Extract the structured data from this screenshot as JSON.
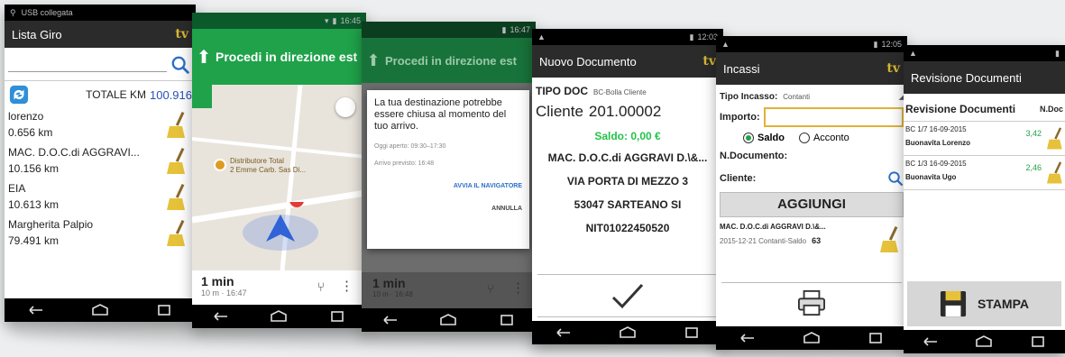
{
  "colors": {
    "accent_green": "#1fa24a",
    "brand_yellow": "#d7b733",
    "status_green": "#22c34a",
    "link_blue": "#2a6fc9"
  },
  "status": {
    "p1": "USB collegata",
    "p2_time": "16:45",
    "p3_time": "16:47",
    "p4_time": "12:03",
    "p5_time": "12:05"
  },
  "p1": {
    "title": "Lista Giro",
    "logo": "tv",
    "total_label": "TOTALE KM",
    "total_value": "100.916",
    "items": [
      {
        "name": "lorenzo",
        "km": "0.656 km"
      },
      {
        "name": "MAC. D.O.C.di AGGRAVI...",
        "km": "10.156 km"
      },
      {
        "name": "EIA",
        "km": "10.613 km"
      },
      {
        "name": "Margherita Palpio",
        "km": "79.491 km"
      }
    ]
  },
  "p2": {
    "title": "Procedi in direzione est",
    "place_line1": "Distributore Total",
    "place_line2": "2 Emme Carb. Sas Di...",
    "eta_time": "1 min",
    "eta_sub": "10 m · 16:47"
  },
  "p3": {
    "title": "Procedi in direzione est",
    "dialog_text": "La tua destinazione potrebbe essere chiusa al momento del tuo arrivo.",
    "open_line": "Oggi aperto: 09:30–17:30",
    "arrival_line": "Arrivo previsto: 16:48",
    "start_nav": "AVVIA IL NAVIGATORE",
    "cancel": "ANNULLA",
    "eta_time": "1 min",
    "eta_sub": "10 m · 16:48"
  },
  "p4": {
    "title": "Nuovo Documento",
    "logo": "tv",
    "tipo_label": "TIPO DOC",
    "tipo_value": "BC-Bolla Cliente",
    "cliente_label": "Cliente",
    "cliente_value": "201.00002",
    "saldo": "Saldo: 0,00 €",
    "addr1": "MAC. D.O.C.di AGGRAVI D.\\&...",
    "addr2": "VIA PORTA DI MEZZO 3",
    "addr3": "53047 SARTEANO SI",
    "addr4": "NIT01022450520"
  },
  "p5": {
    "title": "Incassi",
    "logo": "tv",
    "tipo_label": "Tipo Incasso:",
    "tipo_value": "Contanti",
    "importo_label": "Importo:",
    "importo_value": "",
    "radio_saldo": "Saldo",
    "radio_acconto": "Acconto",
    "ndoc_label": "N.Documento:",
    "cliente_label": "Cliente:",
    "add_button": "AGGIUNGI",
    "item_name": "MAC. D.O.C.di AGGRAVI D.\\&...",
    "item_sub": "2015-12-21 Contanti-Saldo",
    "item_amount": "63"
  },
  "p6": {
    "title": "Revisione Documenti",
    "header_title": "Revisione Documenti",
    "header_col": "N.Doc",
    "rows": [
      {
        "line1": "BC 1/7 16-09-2015",
        "line2": "Buonavita Lorenzo",
        "value": "3,42"
      },
      {
        "line1": "BC 1/3 16-09-2015",
        "line2": "Buonavita Ugo",
        "value": "2,46"
      }
    ],
    "print_label": "STAMPA"
  }
}
